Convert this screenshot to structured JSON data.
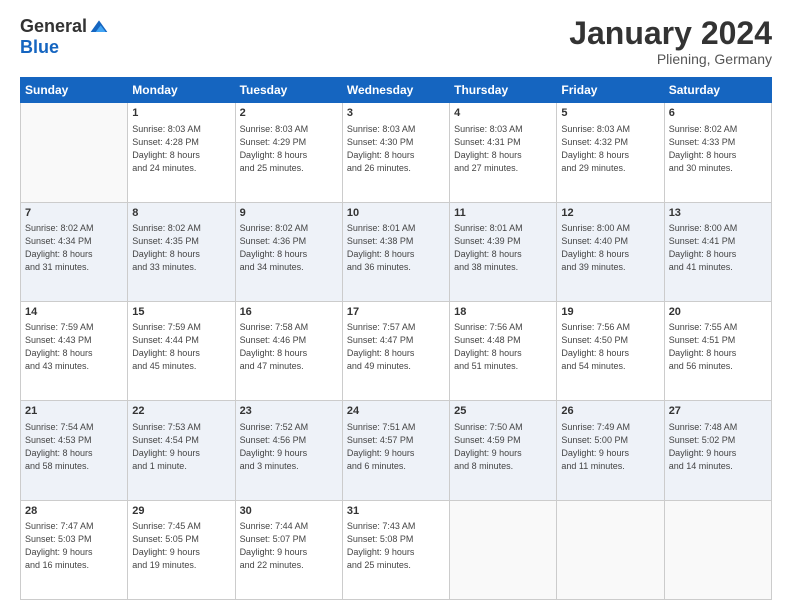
{
  "header": {
    "logo_general": "General",
    "logo_blue": "Blue",
    "month_title": "January 2024",
    "location": "Pliening, Germany"
  },
  "days_of_week": [
    "Sunday",
    "Monday",
    "Tuesday",
    "Wednesday",
    "Thursday",
    "Friday",
    "Saturday"
  ],
  "weeks": [
    {
      "shade": "white",
      "days": [
        {
          "number": "",
          "info": ""
        },
        {
          "number": "1",
          "info": "Sunrise: 8:03 AM\nSunset: 4:28 PM\nDaylight: 8 hours\nand 24 minutes."
        },
        {
          "number": "2",
          "info": "Sunrise: 8:03 AM\nSunset: 4:29 PM\nDaylight: 8 hours\nand 25 minutes."
        },
        {
          "number": "3",
          "info": "Sunrise: 8:03 AM\nSunset: 4:30 PM\nDaylight: 8 hours\nand 26 minutes."
        },
        {
          "number": "4",
          "info": "Sunrise: 8:03 AM\nSunset: 4:31 PM\nDaylight: 8 hours\nand 27 minutes."
        },
        {
          "number": "5",
          "info": "Sunrise: 8:03 AM\nSunset: 4:32 PM\nDaylight: 8 hours\nand 29 minutes."
        },
        {
          "number": "6",
          "info": "Sunrise: 8:02 AM\nSunset: 4:33 PM\nDaylight: 8 hours\nand 30 minutes."
        }
      ]
    },
    {
      "shade": "shade",
      "days": [
        {
          "number": "7",
          "info": "Sunrise: 8:02 AM\nSunset: 4:34 PM\nDaylight: 8 hours\nand 31 minutes."
        },
        {
          "number": "8",
          "info": "Sunrise: 8:02 AM\nSunset: 4:35 PM\nDaylight: 8 hours\nand 33 minutes."
        },
        {
          "number": "9",
          "info": "Sunrise: 8:02 AM\nSunset: 4:36 PM\nDaylight: 8 hours\nand 34 minutes."
        },
        {
          "number": "10",
          "info": "Sunrise: 8:01 AM\nSunset: 4:38 PM\nDaylight: 8 hours\nand 36 minutes."
        },
        {
          "number": "11",
          "info": "Sunrise: 8:01 AM\nSunset: 4:39 PM\nDaylight: 8 hours\nand 38 minutes."
        },
        {
          "number": "12",
          "info": "Sunrise: 8:00 AM\nSunset: 4:40 PM\nDaylight: 8 hours\nand 39 minutes."
        },
        {
          "number": "13",
          "info": "Sunrise: 8:00 AM\nSunset: 4:41 PM\nDaylight: 8 hours\nand 41 minutes."
        }
      ]
    },
    {
      "shade": "white",
      "days": [
        {
          "number": "14",
          "info": "Sunrise: 7:59 AM\nSunset: 4:43 PM\nDaylight: 8 hours\nand 43 minutes."
        },
        {
          "number": "15",
          "info": "Sunrise: 7:59 AM\nSunset: 4:44 PM\nDaylight: 8 hours\nand 45 minutes."
        },
        {
          "number": "16",
          "info": "Sunrise: 7:58 AM\nSunset: 4:46 PM\nDaylight: 8 hours\nand 47 minutes."
        },
        {
          "number": "17",
          "info": "Sunrise: 7:57 AM\nSunset: 4:47 PM\nDaylight: 8 hours\nand 49 minutes."
        },
        {
          "number": "18",
          "info": "Sunrise: 7:56 AM\nSunset: 4:48 PM\nDaylight: 8 hours\nand 51 minutes."
        },
        {
          "number": "19",
          "info": "Sunrise: 7:56 AM\nSunset: 4:50 PM\nDaylight: 8 hours\nand 54 minutes."
        },
        {
          "number": "20",
          "info": "Sunrise: 7:55 AM\nSunset: 4:51 PM\nDaylight: 8 hours\nand 56 minutes."
        }
      ]
    },
    {
      "shade": "shade",
      "days": [
        {
          "number": "21",
          "info": "Sunrise: 7:54 AM\nSunset: 4:53 PM\nDaylight: 8 hours\nand 58 minutes."
        },
        {
          "number": "22",
          "info": "Sunrise: 7:53 AM\nSunset: 4:54 PM\nDaylight: 9 hours\nand 1 minute."
        },
        {
          "number": "23",
          "info": "Sunrise: 7:52 AM\nSunset: 4:56 PM\nDaylight: 9 hours\nand 3 minutes."
        },
        {
          "number": "24",
          "info": "Sunrise: 7:51 AM\nSunset: 4:57 PM\nDaylight: 9 hours\nand 6 minutes."
        },
        {
          "number": "25",
          "info": "Sunrise: 7:50 AM\nSunset: 4:59 PM\nDaylight: 9 hours\nand 8 minutes."
        },
        {
          "number": "26",
          "info": "Sunrise: 7:49 AM\nSunset: 5:00 PM\nDaylight: 9 hours\nand 11 minutes."
        },
        {
          "number": "27",
          "info": "Sunrise: 7:48 AM\nSunset: 5:02 PM\nDaylight: 9 hours\nand 14 minutes."
        }
      ]
    },
    {
      "shade": "white",
      "days": [
        {
          "number": "28",
          "info": "Sunrise: 7:47 AM\nSunset: 5:03 PM\nDaylight: 9 hours\nand 16 minutes."
        },
        {
          "number": "29",
          "info": "Sunrise: 7:45 AM\nSunset: 5:05 PM\nDaylight: 9 hours\nand 19 minutes."
        },
        {
          "number": "30",
          "info": "Sunrise: 7:44 AM\nSunset: 5:07 PM\nDaylight: 9 hours\nand 22 minutes."
        },
        {
          "number": "31",
          "info": "Sunrise: 7:43 AM\nSunset: 5:08 PM\nDaylight: 9 hours\nand 25 minutes."
        },
        {
          "number": "",
          "info": ""
        },
        {
          "number": "",
          "info": ""
        },
        {
          "number": "",
          "info": ""
        }
      ]
    }
  ]
}
